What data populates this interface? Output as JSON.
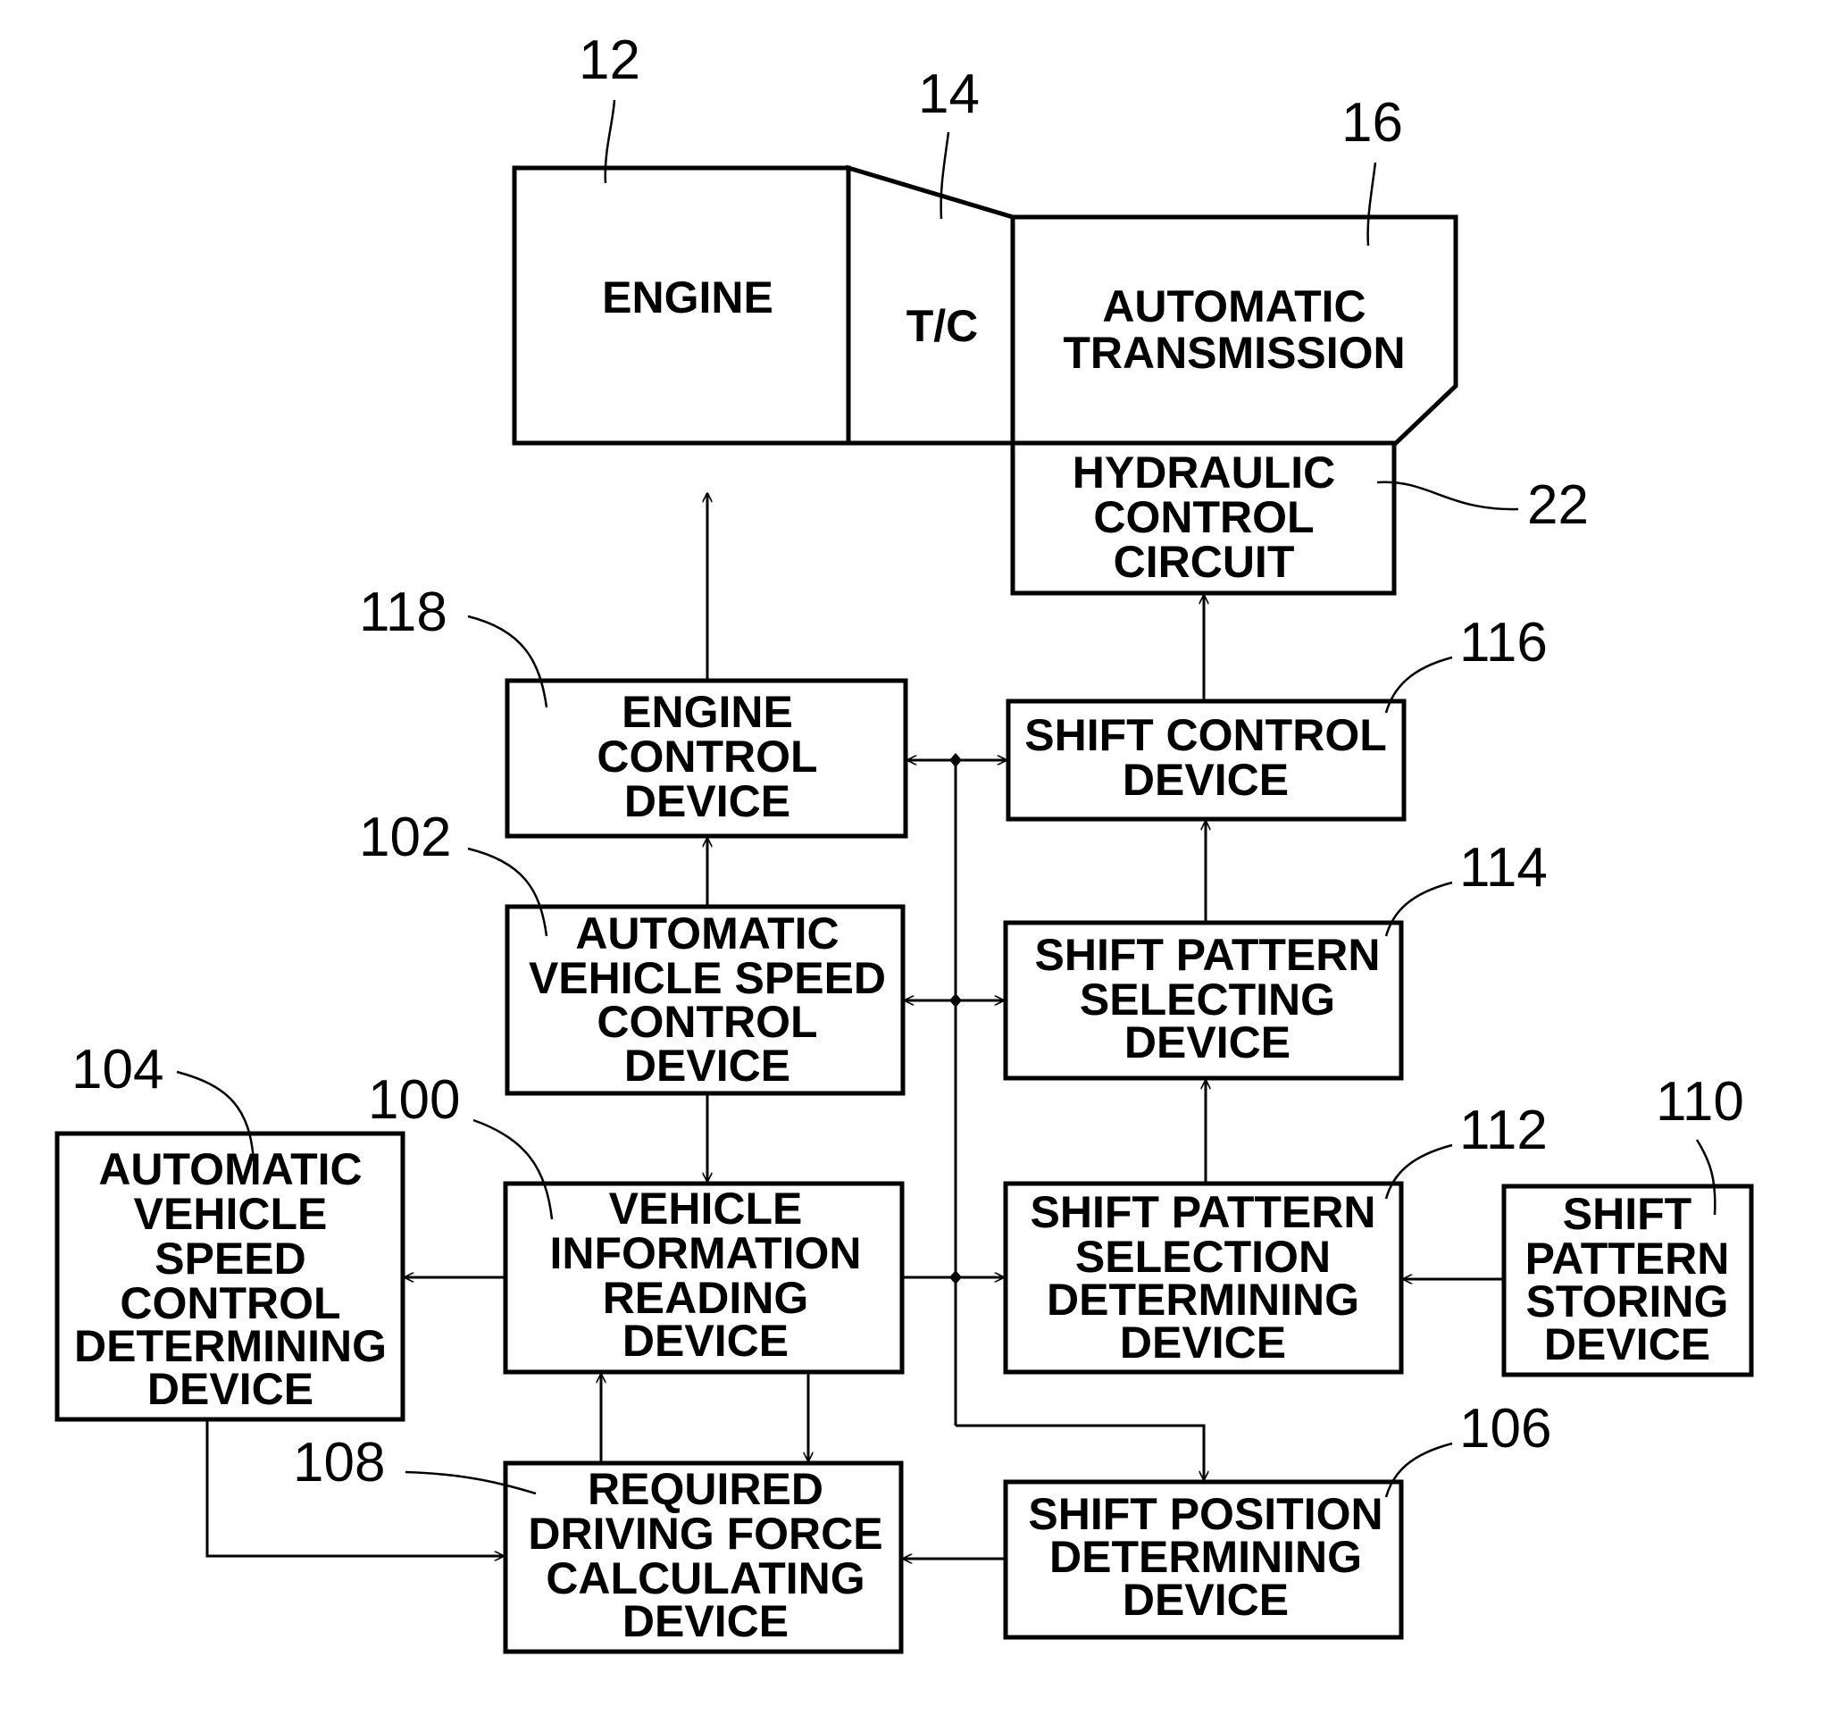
{
  "diagram": {
    "type": "block-diagram",
    "components": {
      "engine": {
        "ref": "12",
        "lines": [
          "ENGINE"
        ]
      },
      "torque_converter": {
        "ref": "14",
        "lines": [
          "T/C"
        ]
      },
      "automatic_transmission": {
        "ref": "16",
        "lines": [
          "AUTOMATIC",
          "TRANSMISSION"
        ]
      },
      "hydraulic_control_circuit": {
        "ref": "22",
        "lines": [
          "HYDRAULIC",
          "CONTROL",
          "CIRCUIT"
        ]
      },
      "engine_control_device": {
        "ref": "118",
        "lines": [
          "ENGINE",
          "CONTROL",
          "DEVICE"
        ]
      },
      "automatic_vehicle_speed_control_device": {
        "ref": "102",
        "lines": [
          "AUTOMATIC",
          "VEHICLE SPEED",
          "CONTROL",
          "DEVICE"
        ]
      },
      "vehicle_information_reading_device": {
        "ref": "100",
        "lines": [
          "VEHICLE",
          "INFORMATION",
          "READING",
          "DEVICE"
        ]
      },
      "automatic_vehicle_speed_control_determining_device": {
        "ref": "104",
        "lines": [
          "AUTOMATIC",
          "VEHICLE",
          "SPEED",
          "CONTROL",
          "DETERMINING",
          "DEVICE"
        ]
      },
      "required_driving_force_calculating_device": {
        "ref": "108",
        "lines": [
          "REQUIRED",
          "DRIVING FORCE",
          "CALCULATING",
          "DEVICE"
        ]
      },
      "shift_control_device": {
        "ref": "116",
        "lines": [
          "SHIFT CONTROL",
          "DEVICE"
        ]
      },
      "shift_pattern_selecting_device": {
        "ref": "114",
        "lines": [
          "SHIFT PATTERN",
          "SELECTING",
          "DEVICE"
        ]
      },
      "shift_pattern_selection_determining_device": {
        "ref": "112",
        "lines": [
          "SHIFT PATTERN",
          "SELECTION",
          "DETERMINING",
          "DEVICE"
        ]
      },
      "shift_pattern_storing_device": {
        "ref": "110",
        "lines": [
          "SHIFT",
          "PATTERN",
          "STORING",
          "DEVICE"
        ]
      },
      "shift_position_determining_device": {
        "ref": "106",
        "lines": [
          "SHIFT POSITION",
          "DETERMINING",
          "DEVICE"
        ]
      }
    },
    "connections": [
      {
        "from": "engine_control_device",
        "to": "engine"
      },
      {
        "from": "shift_control_device",
        "to": "hydraulic_control_circuit"
      },
      {
        "from": "shift_pattern_selecting_device",
        "to": "shift_control_device"
      },
      {
        "from": "shift_pattern_selection_determining_device",
        "to": "shift_pattern_selecting_device"
      },
      {
        "from": "shift_pattern_storing_device",
        "to": "shift_pattern_selection_determining_device"
      },
      {
        "from": "automatic_vehicle_speed_control_device",
        "to": "engine_control_device"
      },
      {
        "from": "automatic_vehicle_speed_control_device",
        "to": "vehicle_information_reading_device"
      },
      {
        "from": "vehicle_information_reading_device",
        "to": "automatic_vehicle_speed_control_determining_device"
      },
      {
        "from": "vehicle_information_reading_device",
        "to": "shift_pattern_selection_determining_device"
      },
      {
        "from": "vehicle_information_reading_device",
        "to": "shift_position_determining_device"
      },
      {
        "from": "vehicle_information_reading_device",
        "to": "required_driving_force_calculating_device"
      },
      {
        "from": "required_driving_force_calculating_device",
        "to": "vehicle_information_reading_device"
      },
      {
        "from": "automatic_vehicle_speed_control_determining_device",
        "to": "required_driving_force_calculating_device"
      },
      {
        "from": "shift_position_determining_device",
        "to": "required_driving_force_calculating_device"
      },
      {
        "from": "bus",
        "to": "engine_control_device",
        "bidirectional": true
      },
      {
        "from": "bus",
        "to": "shift_control_device",
        "bidirectional": true
      },
      {
        "from": "bus",
        "to": "automatic_vehicle_speed_control_device",
        "bidirectional": true
      },
      {
        "from": "bus",
        "to": "shift_pattern_selecting_device",
        "bidirectional": true
      }
    ]
  }
}
